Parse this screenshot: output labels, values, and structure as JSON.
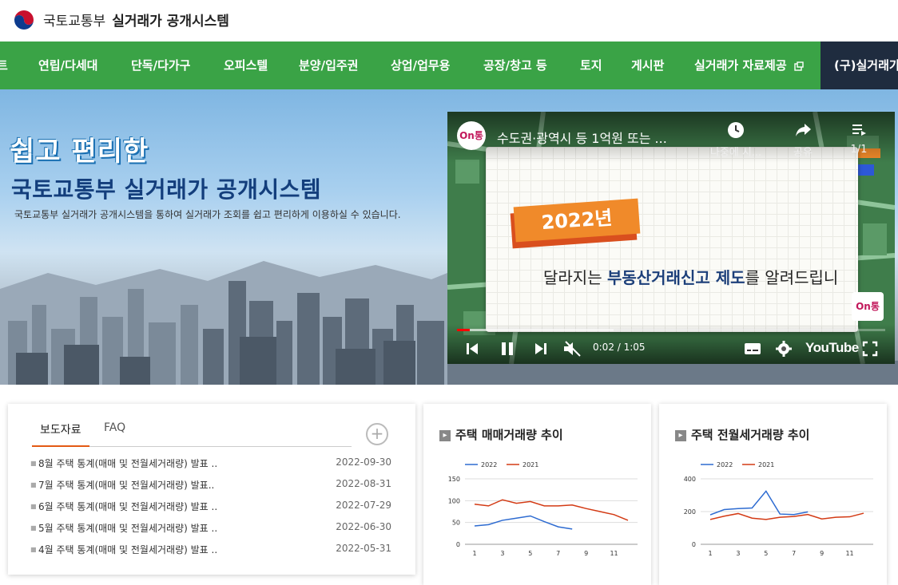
{
  "header": {
    "ministry": "국토교통부",
    "system": "실거래가 공개시스템",
    "logo_icon": "taegeuk-emblem-icon"
  },
  "nav": {
    "items": [
      {
        "label": "트"
      },
      {
        "label": "연립/다세대"
      },
      {
        "label": "단독/다가구"
      },
      {
        "label": "오피스텔"
      },
      {
        "label": "분양/입주권"
      },
      {
        "label": "상업/업무용"
      },
      {
        "label": "공장/창고 등"
      },
      {
        "label": "토지"
      },
      {
        "label": "게시판"
      },
      {
        "label": "실거래가 자료제공"
      }
    ],
    "old_system_label": "(구)실거래가",
    "color": "#3aa346",
    "dark_color": "#1f2c3f"
  },
  "hero": {
    "heading_line1": "쉽고 편리한",
    "heading_line2": "국토교통부 실거래가 공개시스템",
    "description": "국토교통부 실거래가 공개시스템을 통하여 실거래가 조회를 쉽고 편리하게 이용하실 수 있습니다."
  },
  "video": {
    "channel": "On통",
    "title": "수도권·광역시 등 1억원 또는 ...",
    "watch_later_label": "나중에 시...",
    "share_label": "공유",
    "playlist_count": "1/1",
    "tag_text": "2022년",
    "headline_pre": "달라지는 ",
    "headline_bold": "부동산거래신고 제도",
    "headline_post": "를 알려드립니",
    "time_readout": "0:02 / 1:05",
    "brand": "YouTube",
    "progress_fraction": 0.03
  },
  "news": {
    "tab_active": "보도자료",
    "tab_other": "FAQ",
    "more_label": "+",
    "items": [
      {
        "title": "8월 주택 통계(매매 및 전월세거래량) 발표 ..",
        "date": "2022-09-30"
      },
      {
        "title": "7월 주택 통계(매매 및 전월세거래량) 발표..",
        "date": "2022-08-31"
      },
      {
        "title": "6월 주택 통계(매매 및 전월세거래량) 발표 ..",
        "date": "2022-07-29"
      },
      {
        "title": "5월 주택 통계(매매 및 전월세거래량) 발표 ..",
        "date": "2022-06-30"
      },
      {
        "title": "4월 주택 통계(매매 및 전월세거래량) 발표 ..",
        "date": "2022-05-31"
      }
    ]
  },
  "chart_data": [
    {
      "type": "line",
      "title": "주택 매매거래량 추이",
      "x": [
        1,
        2,
        3,
        4,
        5,
        6,
        7,
        8,
        9,
        10,
        11,
        12
      ],
      "xticks": [
        1,
        3,
        5,
        7,
        9,
        11
      ],
      "ylim": [
        0,
        150
      ],
      "yticks": [
        0,
        50,
        100,
        150
      ],
      "legend": "top-left",
      "series": [
        {
          "name": "2022",
          "color": "#2d6bd1",
          "values": [
            42,
            45,
            55,
            60,
            65,
            52,
            40,
            35
          ]
        },
        {
          "name": "2021",
          "color": "#d33a14",
          "values": [
            92,
            88,
            102,
            94,
            98,
            88,
            88,
            90,
            82,
            75,
            68,
            55
          ]
        }
      ]
    },
    {
      "type": "line",
      "title": "주택 전월세거래량 추이",
      "x": [
        1,
        2,
        3,
        4,
        5,
        6,
        7,
        8,
        9,
        10,
        11,
        12
      ],
      "xticks": [
        1,
        3,
        5,
        7,
        9,
        11
      ],
      "ylim": [
        0,
        400
      ],
      "yticks": [
        0,
        200,
        400
      ],
      "legend": "top-left",
      "series": [
        {
          "name": "2022",
          "color": "#2d6bd1",
          "values": [
            180,
            212,
            218,
            222,
            325,
            185,
            182,
            198
          ]
        },
        {
          "name": "2021",
          "color": "#d33a14",
          "values": [
            152,
            172,
            188,
            160,
            152,
            165,
            170,
            182,
            155,
            165,
            168,
            190
          ]
        }
      ]
    }
  ]
}
